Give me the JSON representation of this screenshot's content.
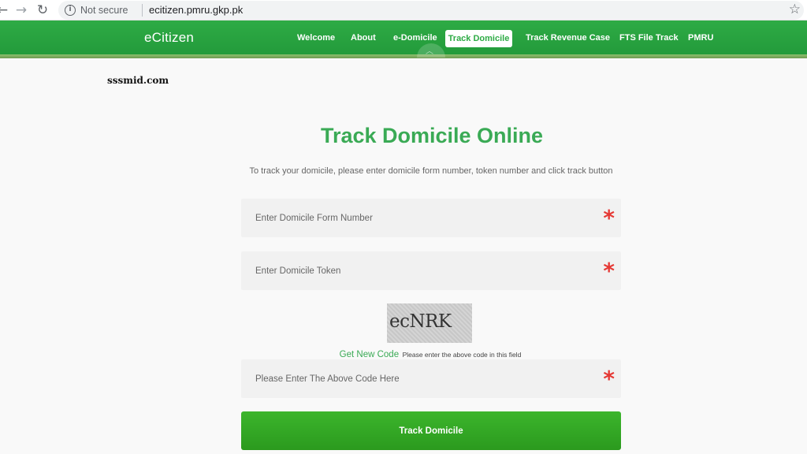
{
  "browser": {
    "security_label": "Not secure",
    "url": "ecitizen.pmru.gkp.pk",
    "back_glyph": "←",
    "forward_glyph": "→",
    "reload_glyph": "↻",
    "info_glyph": "i",
    "star_glyph": "☆"
  },
  "header": {
    "brand": "eCitizen",
    "nav": {
      "welcome": "Welcome",
      "about": "About",
      "edomicile": "e-Domicile",
      "track_domicile": "Track Domicile",
      "track_revenue": "Track Revenue Case",
      "fts": "FTS File Track",
      "pmru": "PMRU"
    },
    "caret_glyph": "︿",
    "colors": {
      "primary_green": "#2eab45",
      "accent_red": "#e53935"
    }
  },
  "watermark": "sssmid.com",
  "main": {
    "title": "Track Domicile Online",
    "subtitle": "To track your domicile, please enter domicile form number, token number and click track button",
    "form_number_placeholder": "Enter Domicile Form Number",
    "token_placeholder": "Enter Domicile Token",
    "captcha_text": "ecNRK",
    "get_new_code": "Get New Code",
    "captcha_help": "Please enter the above code in this field",
    "code_placeholder": "Please Enter The Above Code Here",
    "required_glyph": "*",
    "submit_label": "Track Domicile"
  }
}
